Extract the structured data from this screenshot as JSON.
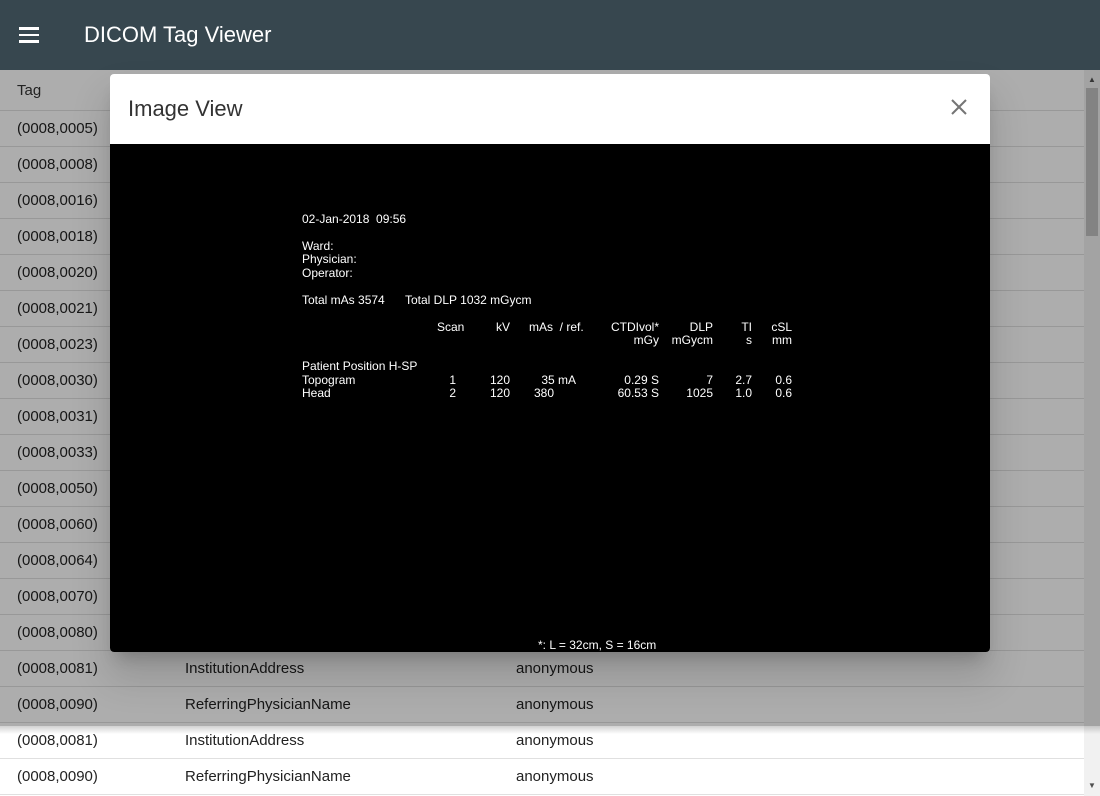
{
  "app": {
    "title": "DICOM Tag Viewer"
  },
  "table": {
    "header": {
      "tag": "Tag"
    },
    "rows": [
      {
        "tag": "(0008,0005)",
        "name": "",
        "value": ""
      },
      {
        "tag": "(0008,0008)",
        "name": "",
        "value": ""
      },
      {
        "tag": "(0008,0016)",
        "name": "",
        "value": ""
      },
      {
        "tag": "(0008,0018)",
        "name": "",
        "value": ""
      },
      {
        "tag": "(0008,0020)",
        "name": "",
        "value": ""
      },
      {
        "tag": "(0008,0021)",
        "name": "",
        "value": ""
      },
      {
        "tag": "(0008,0023)",
        "name": "",
        "value": ""
      },
      {
        "tag": "(0008,0030)",
        "name": "",
        "value": ""
      },
      {
        "tag": "(0008,0031)",
        "name": "",
        "value": ""
      },
      {
        "tag": "(0008,0033)",
        "name": "",
        "value": ""
      },
      {
        "tag": "(0008,0050)",
        "name": "",
        "value": ""
      },
      {
        "tag": "(0008,0060)",
        "name": "",
        "value": ""
      },
      {
        "tag": "(0008,0064)",
        "name": "",
        "value": ""
      },
      {
        "tag": "(0008,0070)",
        "name": "",
        "value": ""
      },
      {
        "tag": "(0008,0080)",
        "name": "",
        "value": ""
      },
      {
        "tag": "(0008,0081)",
        "name": "InstitutionAddress",
        "value": "anonymous"
      },
      {
        "tag": "(0008,0090)",
        "name": "ReferringPhysicianName",
        "value": "anonymous"
      },
      {
        "tag": "(0008,0081)",
        "name": "InstitutionAddress",
        "value": "anonymous"
      },
      {
        "tag": "(0008,0090)",
        "name": "ReferringPhysicianName",
        "value": "anonymous"
      }
    ]
  },
  "dialog": {
    "title": "Image View",
    "image": {
      "datetime": "02-Jan-2018  09:56",
      "ward": "Ward:",
      "physician": "Physician:",
      "operator": "Operator:",
      "total_mas": "Total mAs 3574",
      "total_dlp": "Total DLP 1032 mGycm",
      "headers": {
        "scan": "Scan",
        "kv": "kV",
        "mas_ref": "mAs  / ref.",
        "ctdivol": "CTDIvol*",
        "ctdivol_unit": "mGy",
        "dlp": "DLP",
        "dlp_unit": "mGycm",
        "ti": "TI",
        "ti_unit": "s",
        "csl": "cSL",
        "csl_unit": "mm"
      },
      "patient_position": "Patient Position H-SP",
      "rows": [
        {
          "name": "Topogram",
          "scan": "1",
          "kv": "120",
          "mas": "35 mA",
          "ctdivol": "0.29 S",
          "dlp": "7",
          "ti": "2.7",
          "csl": "0.6"
        },
        {
          "name": "Head",
          "scan": "2",
          "kv": "120",
          "mas": "380",
          "ctdivol": "60.53 S",
          "dlp": "1025",
          "ti": "1.0",
          "csl": "0.6"
        }
      ],
      "footnote": "*: L = 32cm, S = 16cm"
    }
  }
}
